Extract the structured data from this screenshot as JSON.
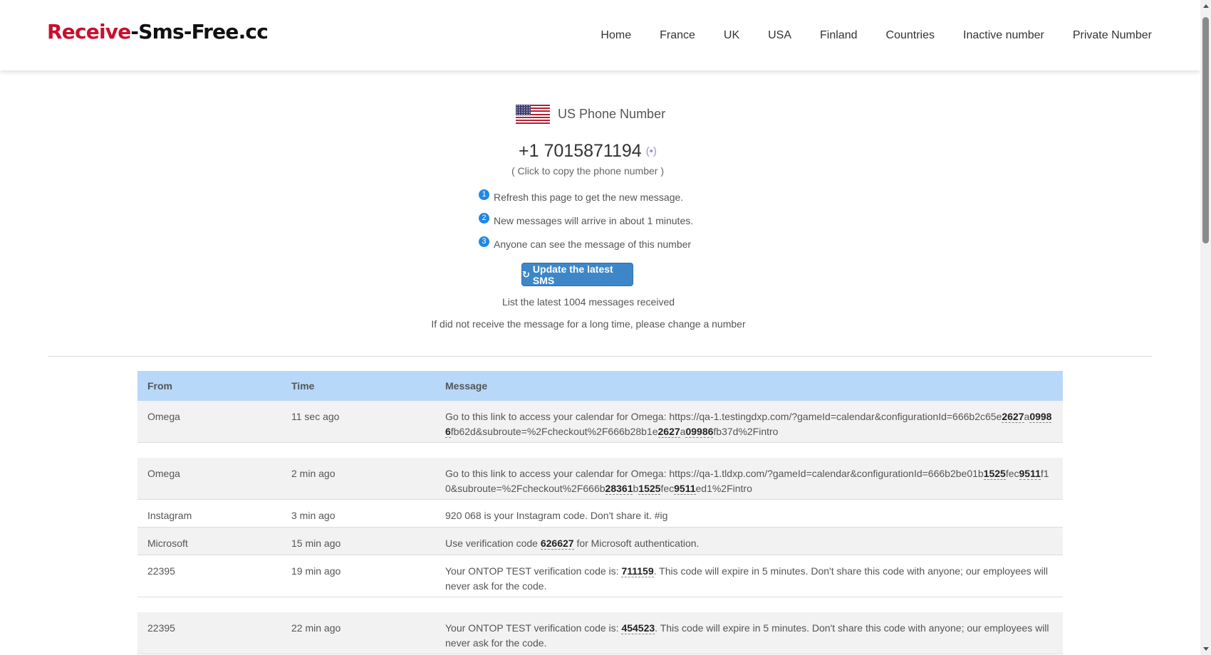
{
  "header": {
    "logo_red": "Receive",
    "logo_rest": "-Sms-Free.cc",
    "nav": [
      "Home",
      "France",
      "UK",
      "USA",
      "Finland",
      "Countries",
      "Inactive number",
      "Private Number"
    ]
  },
  "info": {
    "country_title": "US Phone Number",
    "phone_number": "+1 7015871194",
    "signal_icon": "(•)",
    "copy_hint": "( Click to copy the phone number )",
    "tips": [
      {
        "num": "1",
        "text": "Refresh this page to get the new message."
      },
      {
        "num": "2",
        "text": "New messages will arrive in about 1 minutes."
      },
      {
        "num": "3",
        "text": "Anyone can see the message of this number"
      }
    ],
    "update_button": "Update the latest SMS",
    "refresh_icon": "↻",
    "count_note": "List the latest 1004 messages received",
    "change_note": "If did not receive the message for a long time, please change a number"
  },
  "table": {
    "headers": {
      "from": "From",
      "time": "Time",
      "message": "Message"
    },
    "rows": [
      {
        "from": "Omega",
        "time": "11 sec ago",
        "parts": [
          {
            "t": "Go to this link to access your calendar for Omega: https://qa-1.testingdxp.com/?gameId=calendar&configurationId=666b2c65e"
          },
          {
            "t": "2627",
            "c": true
          },
          {
            "t": "a"
          },
          {
            "t": "09986",
            "c": true
          },
          {
            "t": "fb62d&subroute=%2Fcheckout%2F666b28b1e"
          },
          {
            "t": "2627",
            "c": true
          },
          {
            "t": "a"
          },
          {
            "t": "09986",
            "c": true
          },
          {
            "t": "fb37d%2Fintro"
          }
        ]
      },
      {
        "from": "Omega",
        "time": "2 min ago",
        "parts": [
          {
            "t": "Go to this link to access your calendar for Omega: https://qa-1.tldxp.com/?gameId=calendar&configurationId=666b2be01b"
          },
          {
            "t": "1525",
            "c": true
          },
          {
            "t": "fec"
          },
          {
            "t": "9511",
            "c": true
          },
          {
            "t": "f10&subroute=%2Fcheckout%2F666b"
          },
          {
            "t": "28361",
            "c": true
          },
          {
            "t": "b"
          },
          {
            "t": "1525",
            "c": true
          },
          {
            "t": "fec"
          },
          {
            "t": "9511",
            "c": true
          },
          {
            "t": "ed1%2Fintro"
          }
        ]
      },
      {
        "from": "Instagram",
        "time": "3 min ago",
        "parts": [
          {
            "t": "920 068 is your Instagram code. Don't share it. #ig"
          }
        ]
      },
      {
        "from": "Microsoft",
        "time": "15 min ago",
        "parts": [
          {
            "t": "Use verification code "
          },
          {
            "t": "626627",
            "c": true
          },
          {
            "t": " for Microsoft authentication."
          }
        ]
      },
      {
        "from": "22395",
        "time": "19 min ago",
        "parts": [
          {
            "t": "Your ONTOP TEST verification code is: "
          },
          {
            "t": "711159",
            "c": true
          },
          {
            "t": ". This code will expire in 5 minutes. Don't share this code with anyone; our employees will never ask for the code."
          }
        ]
      },
      {
        "from": "22395",
        "time": "22 min ago",
        "parts": [
          {
            "t": "Your ONTOP TEST verification code is: "
          },
          {
            "t": "454523",
            "c": true
          },
          {
            "t": ". This code will expire in 5 minutes. Don't share this code with anyone; our employees will never ask for the code."
          }
        ]
      }
    ]
  }
}
